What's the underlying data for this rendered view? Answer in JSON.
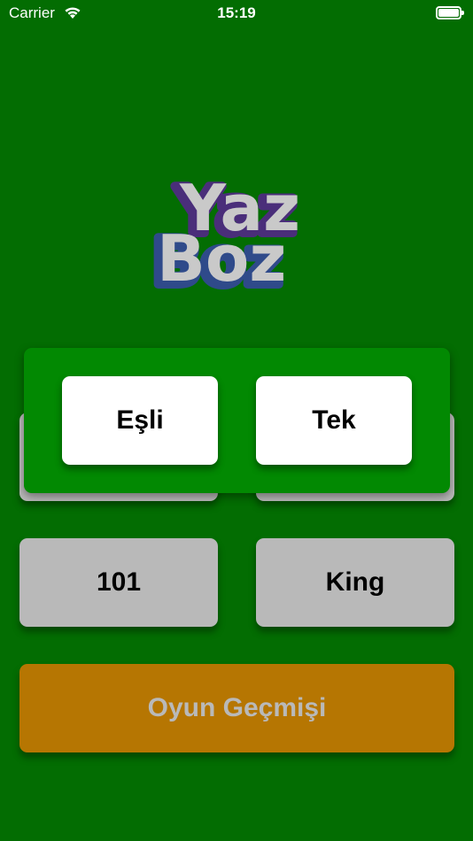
{
  "status_bar": {
    "carrier": "Carrier",
    "time": "15:19"
  },
  "logo": {
    "line1": "Yaz",
    "line2": "Boz"
  },
  "menu": {
    "hidden_left": "",
    "hidden_right": "",
    "game_101": "101",
    "game_king": "King",
    "history": "Oyun Geçmişi"
  },
  "mode_popup": {
    "paired": "Eşli",
    "single": "Tek"
  },
  "colors": {
    "background": "#036d02",
    "popup": "#028902",
    "tile": "#b9b9b9",
    "history": "#b67602",
    "logo_shadow_top": "#4a2e7a",
    "logo_shadow_bottom": "#2f4a8a",
    "logo_text": "#c9c9c9"
  },
  "icons": {
    "wifi": "wifi-icon",
    "battery": "battery-icon"
  }
}
